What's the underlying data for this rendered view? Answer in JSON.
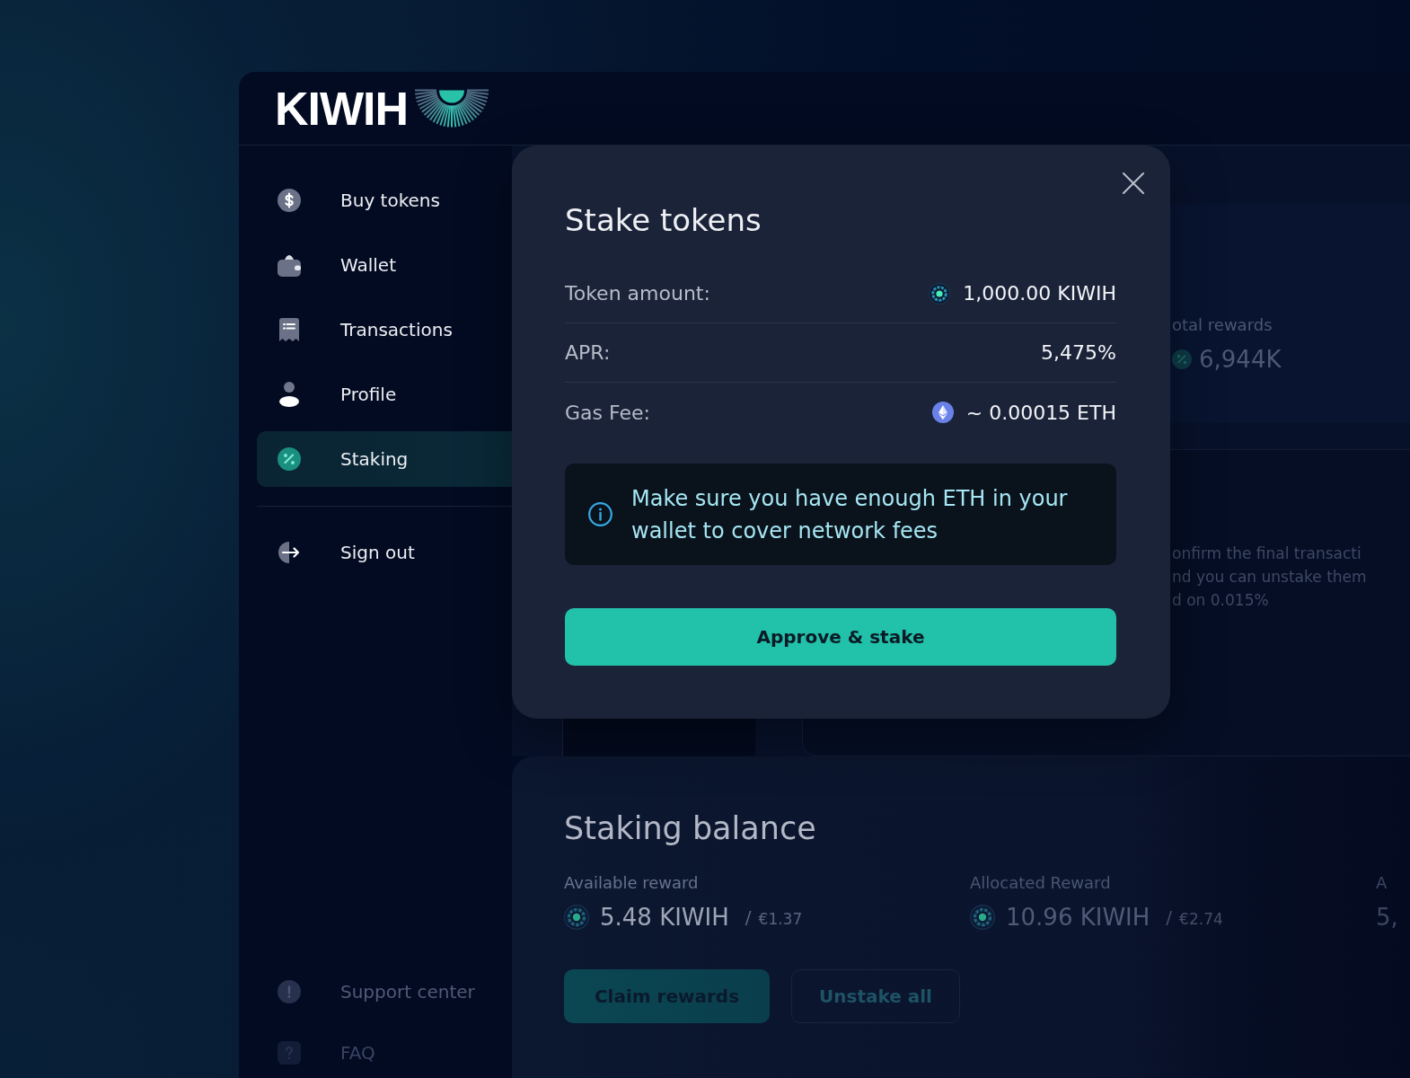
{
  "header": {
    "logo_text": "KIWIH"
  },
  "sidebar": {
    "items": [
      {
        "label": "Buy tokens",
        "selected": false
      },
      {
        "label": "Wallet",
        "selected": false
      },
      {
        "label": "Transactions",
        "selected": false
      },
      {
        "label": "Profile",
        "selected": false
      },
      {
        "label": "Staking",
        "selected": true
      }
    ],
    "sign_out": {
      "label": "Sign out"
    },
    "footer_items": [
      {
        "label": "Support center"
      },
      {
        "label": "FAQ"
      }
    ]
  },
  "background": {
    "stat": {
      "label": "otal rewards",
      "value": "6,944K"
    },
    "note_lines": [
      "onfirm the final transacti",
      "nd you can unstake them",
      "d on 0.015%"
    ]
  },
  "staking_balance": {
    "title": "Staking balance",
    "columns": [
      {
        "kind": "token",
        "label": "Available reward",
        "amount": "5.48 KIWIH",
        "separator": "/",
        "fiat": "€1.37"
      },
      {
        "kind": "token",
        "label": "Allocated Reward",
        "amount": "10.96 KIWIH",
        "separator": "/",
        "fiat": "€2.74"
      },
      {
        "kind": "plain",
        "label": "A",
        "amount": "5,"
      }
    ],
    "buttons": [
      {
        "kind": "primary",
        "label": "Claim rewards"
      },
      {
        "kind": "outline",
        "label": "Unstake all"
      }
    ]
  },
  "modal": {
    "title": "Stake tokens",
    "rows": [
      {
        "kind": "token",
        "label": "Token amount:",
        "value": "1,000.00 KIWIH"
      },
      {
        "kind": "plain",
        "label": "APR:",
        "value": "5,475%"
      },
      {
        "kind": "fee",
        "label": "Gas Fee:",
        "value": "~ 0.00015 ETH"
      }
    ],
    "notice": "Make sure you have enough ETH in your wallet to cover network fees",
    "button": "Approve & stake"
  }
}
